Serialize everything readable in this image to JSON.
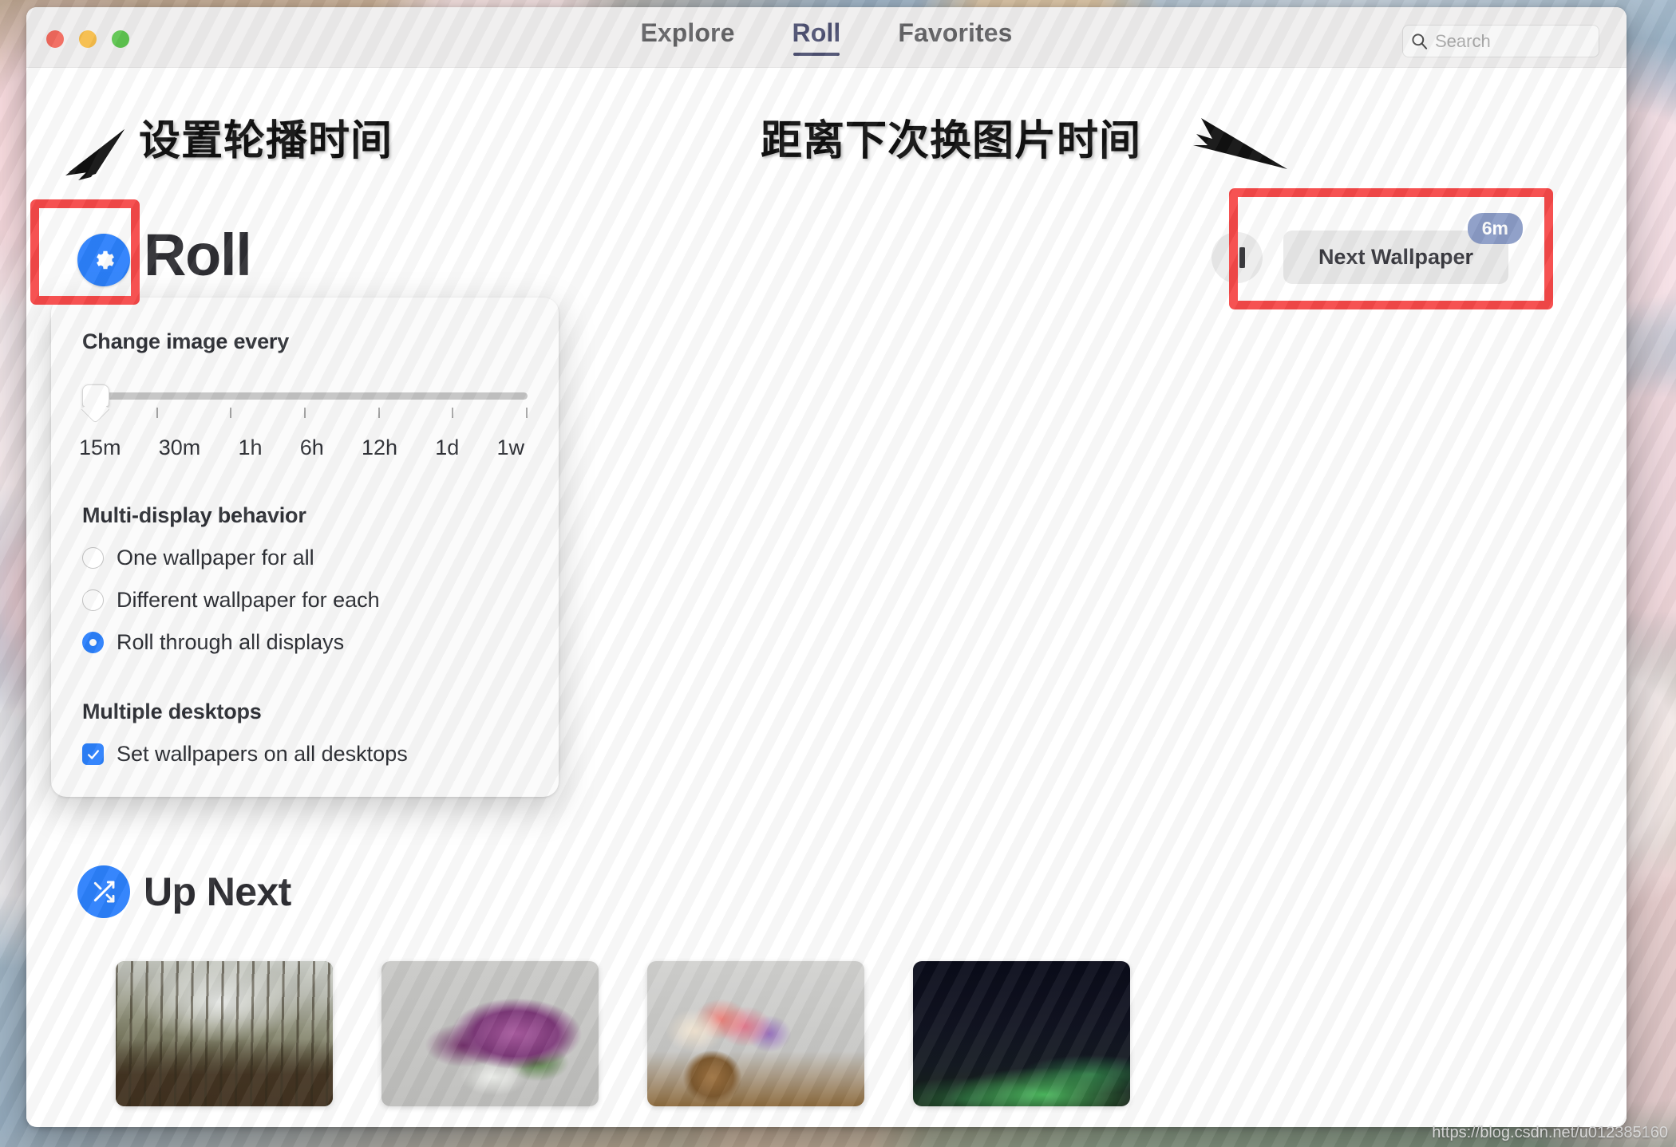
{
  "window": {
    "traffic_lights": [
      {
        "name": "close",
        "color": "#ec6a5f"
      },
      {
        "name": "minimize",
        "color": "#f4bd4f"
      },
      {
        "name": "zoom",
        "color": "#61c454"
      }
    ]
  },
  "tabs": [
    {
      "label": "Explore",
      "active": false
    },
    {
      "label": "Roll",
      "active": true
    },
    {
      "label": "Favorites",
      "active": false
    }
  ],
  "search": {
    "placeholder": "Search",
    "value": "",
    "icon": "search-icon"
  },
  "roll": {
    "title": "Roll",
    "gear_icon": "gear-icon",
    "pause_icon": "pause-icon",
    "next_label": "Next Wallpaper",
    "next_badge": "6m"
  },
  "settings_popover": {
    "change_image_every": {
      "title": "Change image every",
      "selected": "15m",
      "ticks": [
        "15m",
        "30m",
        "1h",
        "6h",
        "12h",
        "1d",
        "1w"
      ]
    },
    "multi_display": {
      "title": "Multi-display behavior",
      "options": [
        {
          "label": "One wallpaper for all",
          "selected": false
        },
        {
          "label": "Different wallpaper for each",
          "selected": false
        },
        {
          "label": "Roll through all displays",
          "selected": true
        }
      ]
    },
    "multiple_desktops": {
      "title": "Multiple desktops",
      "options": [
        {
          "label": "Set wallpapers on all desktops",
          "checked": true
        }
      ]
    }
  },
  "up_next": {
    "title": "Up Next",
    "shuffle_icon": "shuffle-icon",
    "thumbnails": [
      {
        "name": "foggy-forest-road"
      },
      {
        "name": "purple-flowers-in-white-pitcher"
      },
      {
        "name": "flower-basket"
      },
      {
        "name": "aurora-night-sky"
      }
    ]
  },
  "annotations": [
    {
      "text": "设置轮播时间"
    },
    {
      "text": "距离下次换图片时间"
    }
  ],
  "highlights": {
    "color": "#ef4b4b"
  },
  "watermark": "https://blog.csdn.net/u012385160"
}
